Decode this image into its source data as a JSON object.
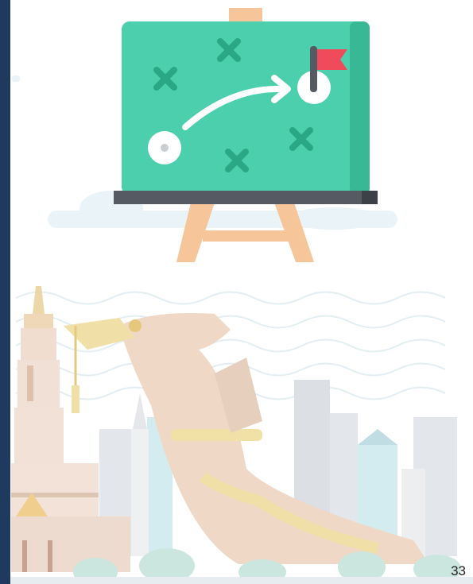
{
  "slide": {
    "page_number": "33"
  },
  "illustration": {
    "board_icon": "strategy-board-icon",
    "flag_icon": "flag-icon",
    "x_marks_icon": "x-mark-icon",
    "arrow_icon": "curved-arrow-icon",
    "temple_icon": "temple-spire-icon",
    "boat_icon": "royal-barge-figurehead-icon",
    "skyline_icon": "city-skyline-icon"
  },
  "colors": {
    "left_bar": "#1f3a5f",
    "board": "#4ccfad",
    "board_side": "#38b894",
    "flag": "#ef4b5b",
    "easel": "#f6c69a",
    "ledge": "#555a63"
  }
}
